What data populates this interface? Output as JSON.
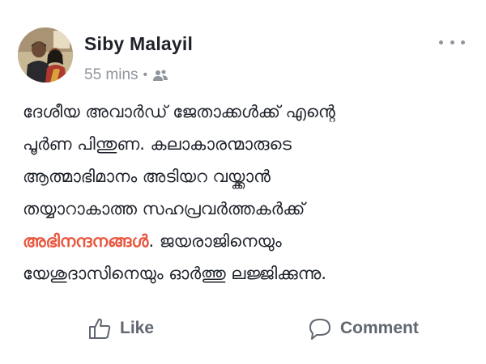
{
  "post": {
    "author": {
      "name": "Siby Malayil",
      "avatar_icon": "profile-photo-two-people"
    },
    "timestamp": "55 mins",
    "separator": "•",
    "audience_icon": "friends-icon",
    "more_icon": "more-options-icon",
    "body": {
      "line1": "ദേശീയ അവാർഡ് ജേതാക്കൾക്ക് എന്റെ",
      "line2": "പൂർണ പിന്തുണ. കലാകാരന്മാരുടെ",
      "line3": "ആത്മാഭിമാനം അടിയറ വയ്ക്കാൻ",
      "line4": "തയ്യാറാകാത്ത സഹപ്രവർത്തകർക്ക്",
      "line5_highlight": "അഭിനന്ദനങ്ങൾ",
      "line5_rest": ". ജയരാജിനെയും",
      "line6": "യേശുദാസിനെയും ഓർത്തു ലജ്ജിക്കുന്നു."
    },
    "highlight_color": "#e9573f",
    "actions": {
      "like_label": "Like",
      "comment_label": "Comment"
    }
  }
}
